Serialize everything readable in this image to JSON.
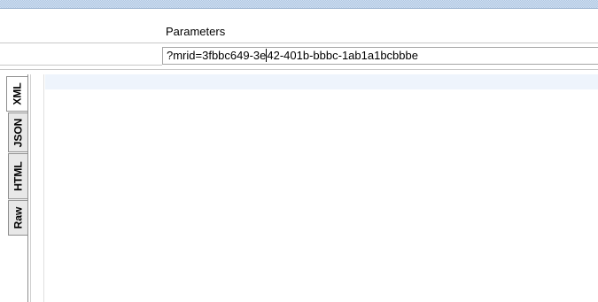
{
  "parameters": {
    "label": "Parameters",
    "value_before_caret": "?mrid=3fbbc649-3e",
    "value_after_caret": "42-401b-bbbc-1ab1a1bcbbbe"
  },
  "response_tabs": [
    {
      "label": "XML",
      "active": true
    },
    {
      "label": "JSON",
      "active": false
    },
    {
      "label": "HTML",
      "active": false
    },
    {
      "label": "Raw",
      "active": false
    }
  ],
  "colors": {
    "title_bar": "#cfe0f3",
    "current_line_highlight": "#eef4fc",
    "tab_inactive": "#e8e8e8",
    "border": "#a6a6a6"
  }
}
